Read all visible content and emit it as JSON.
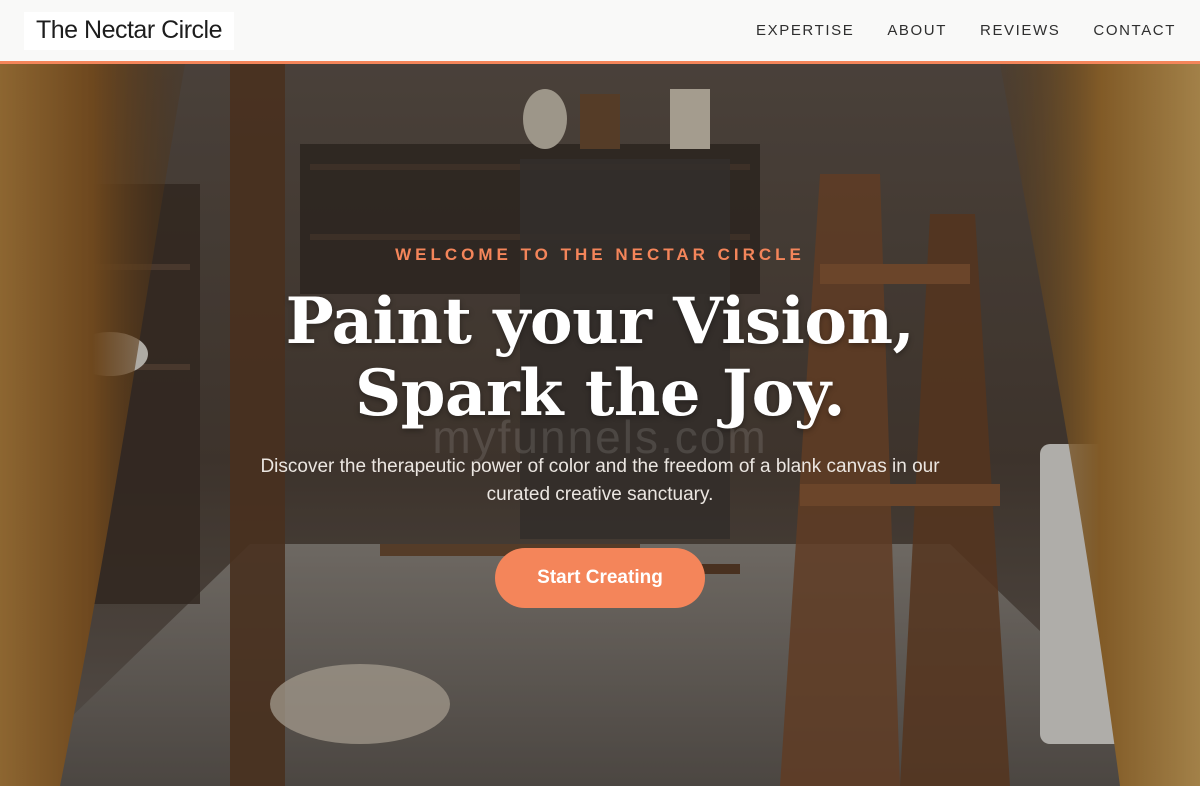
{
  "brand": {
    "name": "The Nectar Circle"
  },
  "nav": {
    "links": [
      {
        "label": "EXPERTISE"
      },
      {
        "label": "ABOUT"
      },
      {
        "label": "REVIEWS"
      },
      {
        "label": "CONTACT"
      }
    ]
  },
  "hero": {
    "eyebrow": "WELCOME TO THE NECTAR CIRCLE",
    "headline_line1": "Paint your Vision,",
    "headline_line2": "Spark the Joy.",
    "subtext": "Discover the therapeutic power of color and the freedom of a blank canvas in our curated creative sanctuary.",
    "cta_label": "Start Creating",
    "watermark": "myfunnels.com",
    "background_image": "art-studio-with-easels-photo"
  },
  "colors": {
    "accent": "#f4855a",
    "navbar_bg": "#f9f9f8",
    "text_dark": "#1d1d1d"
  }
}
